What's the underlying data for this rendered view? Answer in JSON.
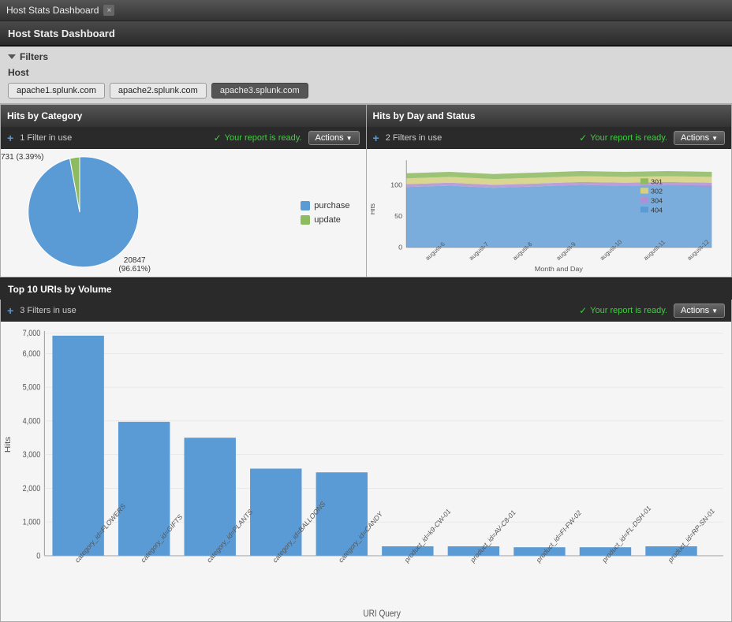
{
  "window": {
    "title": "Host Stats Dashboard",
    "close_label": "×"
  },
  "app_header": {
    "title": "Host Stats Dashboard"
  },
  "filters": {
    "section_label": "Filters",
    "host_label": "Host",
    "tags": [
      {
        "label": "apache1.splunk.com",
        "active": false
      },
      {
        "label": "apache2.splunk.com",
        "active": false
      },
      {
        "label": "apache3.splunk.com",
        "active": true
      }
    ]
  },
  "panels": {
    "hits_by_category": {
      "title": "Hits by Category",
      "filter_count": "1 Filter in use",
      "report_ready": "Your report is ready.",
      "actions_label": "Actions",
      "pie": {
        "label_top": "731 (3.39%)",
        "label_bottom_value": "20847",
        "label_bottom_pct": "(96.61%)"
      },
      "legend": [
        {
          "label": "purchase",
          "color": "#5b9bd5"
        },
        {
          "label": "update",
          "color": "#8dbb5f"
        }
      ]
    },
    "hits_by_day": {
      "title": "Hits by Day and Status",
      "filter_count": "2 Filters in use",
      "report_ready": "Your report is ready.",
      "actions_label": "Actions",
      "x_label": "Month and Day",
      "y_label": "Hits",
      "x_ticks": [
        "august-6",
        "august-7",
        "august-8",
        "august-9",
        "august-10",
        "august-11",
        "august-12"
      ],
      "y_ticks": [
        "0",
        "50",
        "100"
      ],
      "legend": [
        {
          "label": "301",
          "color": "#8dbb5f"
        },
        {
          "label": "302",
          "color": "#d4d080"
        },
        {
          "label": "304",
          "color": "#b08fd4"
        },
        {
          "label": "404",
          "color": "#5b9bd5"
        }
      ]
    },
    "top_uris": {
      "title": "Top 10 URIs by Volume",
      "filter_count": "3 Filters in use",
      "report_ready": "Your report is ready.",
      "actions_label": "Actions",
      "x_label": "URI Query",
      "y_label": "Hits",
      "bars": [
        {
          "label": "category_id=FLOWERS",
          "value": 6900,
          "height_pct": 97
        },
        {
          "label": "category_id=GIFTS",
          "value": 4200,
          "height_pct": 59
        },
        {
          "label": "category_id=PLANTS",
          "value": 3700,
          "height_pct": 52
        },
        {
          "label": "category_id=BALLOONS",
          "value": 2700,
          "height_pct": 38
        },
        {
          "label": "category_id=CANDY",
          "value": 2600,
          "height_pct": 37
        },
        {
          "label": "product_id=k9-CW-01",
          "value": 300,
          "height_pct": 4
        },
        {
          "label": "product_id=AV-C8-01",
          "value": 300,
          "height_pct": 4
        },
        {
          "label": "product_id=FI-FW-02",
          "value": 280,
          "height_pct": 4
        },
        {
          "label": "product_id=FL-DSH-01",
          "value": 270,
          "height_pct": 4
        },
        {
          "label": "product_id=RP-SN-01",
          "value": 290,
          "height_pct": 4
        }
      ],
      "y_ticks": [
        "0",
        "1,000",
        "2,000",
        "3,000",
        "4,000",
        "5,000",
        "6,000",
        "7,000"
      ]
    }
  }
}
